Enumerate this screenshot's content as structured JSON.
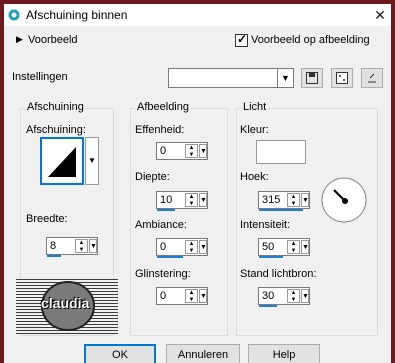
{
  "window": {
    "title": "Afschuining binnen",
    "close_glyph": "✕"
  },
  "preview": {
    "label": "Voorbeeld",
    "checkbox_label": "Voorbeeld op afbeelding",
    "checked": true
  },
  "settings": {
    "label": "Instellingen",
    "value": ""
  },
  "groups": {
    "bevel": {
      "title": "Afschuining",
      "shape_label": "Afschuining:",
      "width_label": "Breedte:",
      "width_value": "8"
    },
    "image": {
      "title": "Afbeelding",
      "smoothness_label": "Effenheid:",
      "smoothness_value": "0",
      "depth_label": "Diepte:",
      "depth_value": "10",
      "ambience_label": "Ambiance:",
      "ambience_value": "0",
      "shininess_label": "Glinstering:",
      "shininess_value": "0"
    },
    "light": {
      "title": "Licht",
      "color_label": "Kleur:",
      "color_value": "#ffffff",
      "angle_label": "Hoek:",
      "angle_value": "315",
      "intensity_label": "Intensiteit:",
      "intensity_value": "50",
      "elevation_label": "Stand lichtbron:",
      "elevation_value": "30"
    }
  },
  "logo": {
    "text": "claudia"
  },
  "buttons": {
    "ok": "OK",
    "cancel": "Annuleren",
    "help": "Help"
  }
}
